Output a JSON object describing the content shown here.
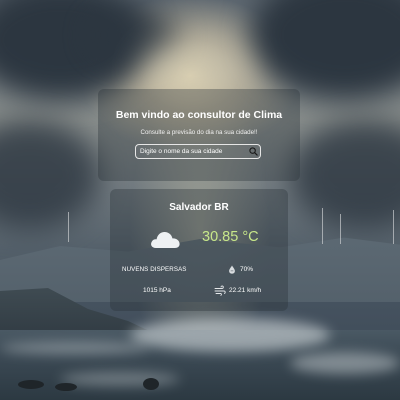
{
  "search": {
    "title": "Bem vindo ao consultor de Clima",
    "subtitle": "Consulte a previsão do dia na sua cidade!!",
    "placeholder": "Digite o nome da sua cidade",
    "button_icon": "search-icon"
  },
  "weather": {
    "city": "Salvador BR",
    "temperature": "30.85 °C",
    "condition_icon": "cloud-icon",
    "description": "NUVENS DISPERSAS",
    "humidity_icon": "humidity-drop-icon",
    "humidity": "70%",
    "pressure": "1015 hPa",
    "wind_icon": "wind-icon",
    "wind_speed": "22.21 km/h"
  },
  "colors": {
    "temperature": "#c7e78a",
    "text": "#ffffff",
    "panel": "rgba(40,48,55,0.35)"
  }
}
